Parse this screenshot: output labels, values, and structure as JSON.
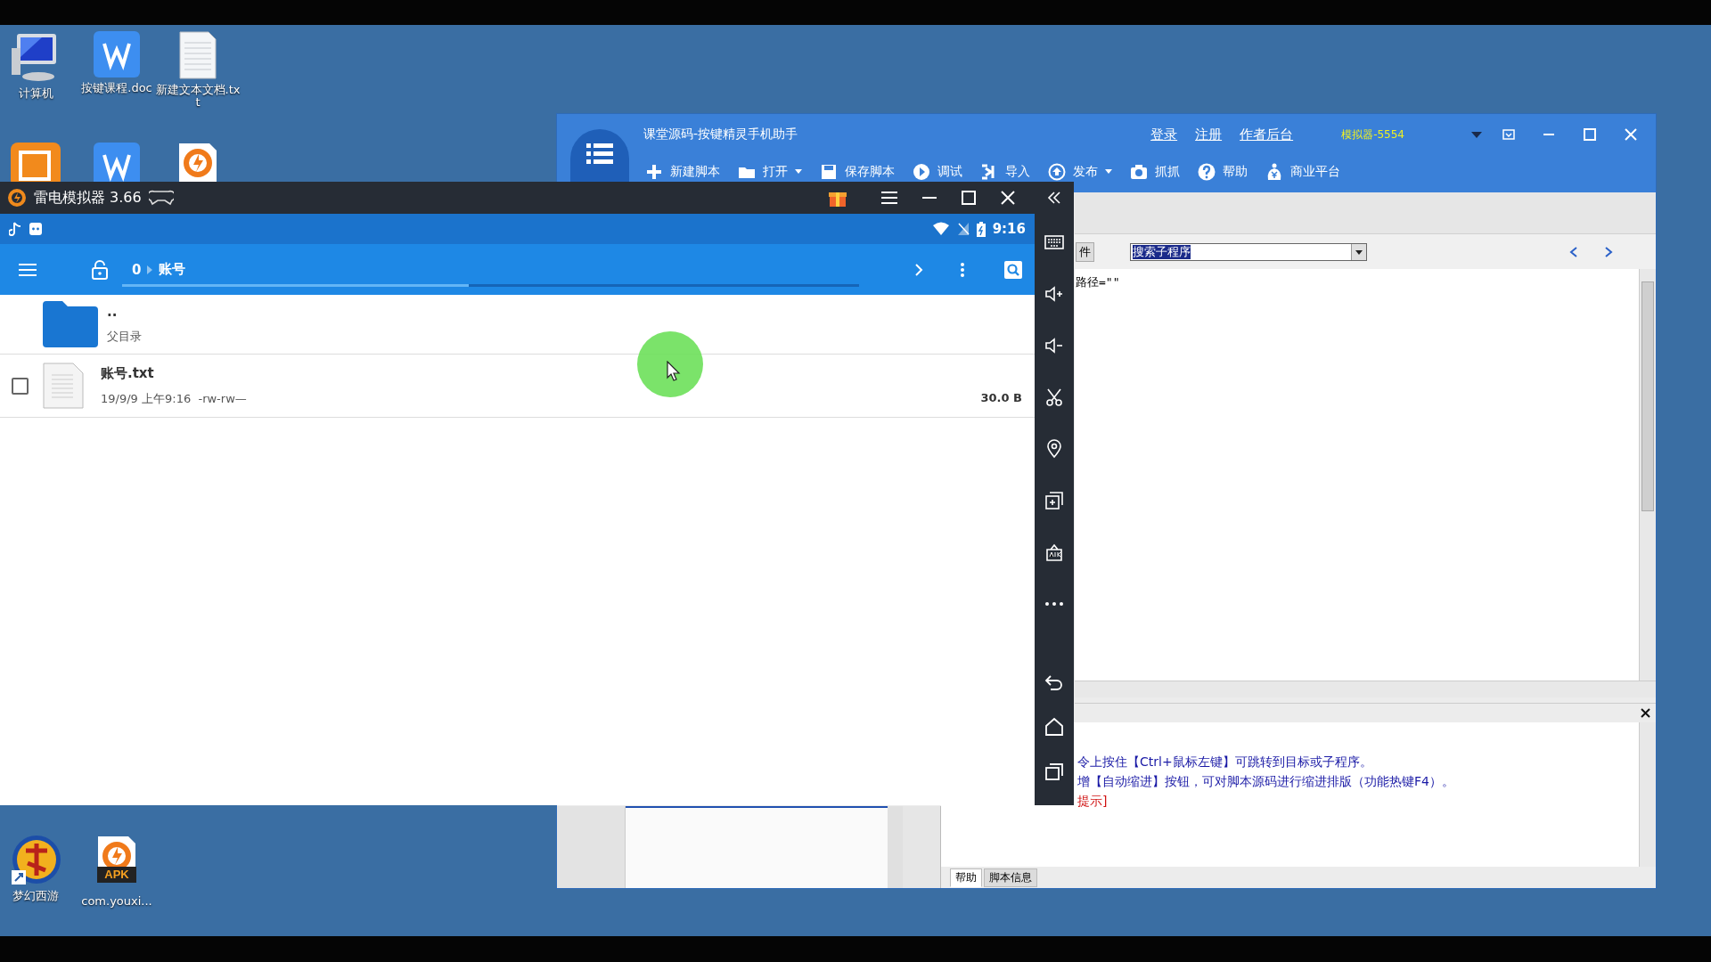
{
  "desktop_icons": [
    {
      "label": "计算机",
      "kind": "computer"
    },
    {
      "label": "按键课程.doc",
      "kind": "word"
    },
    {
      "label": "新建文本文档.txt",
      "kind": "text"
    },
    {
      "kind": "flash"
    },
    {
      "kind": "word"
    },
    {
      "kind": "ld"
    }
  ],
  "bottom_icons": [
    {
      "label": "梦幻西游",
      "kind": "game"
    },
    {
      "label": "com.youxi...",
      "kind": "apk",
      "badge": "APK"
    }
  ],
  "editor": {
    "title": "课堂源码-按键精灵手机助手",
    "links": [
      "登录",
      "注册",
      "作者后台"
    ],
    "device": "模拟器-5554",
    "toolbar": [
      {
        "label": "新建脚本",
        "kind": "plus",
        "dropdown": false
      },
      {
        "label": "打开",
        "kind": "folder",
        "dropdown": true
      },
      {
        "label": "保存脚本",
        "kind": "save",
        "dropdown": false
      },
      {
        "label": "调试",
        "kind": "play",
        "dropdown": false
      },
      {
        "label": "导入",
        "kind": "import",
        "dropdown": false
      },
      {
        "label": "发布",
        "kind": "publish",
        "dropdown": true
      },
      {
        "label": "抓抓",
        "kind": "camera",
        "dropdown": false
      },
      {
        "label": "帮助",
        "kind": "help",
        "dropdown": false
      },
      {
        "label": "商业平台",
        "kind": "money",
        "dropdown": false
      }
    ],
    "tab_fragment": "件",
    "search": {
      "value": "搜索子程序"
    },
    "code_lines": [
      "路径=\"\""
    ],
    "log_lines": [
      {
        "text": "令上按住【Ctrl+鼠标左键】可跳转到目标或子程序。",
        "color": "#1a1aa6"
      },
      {
        "text": "增【自动缩进】按钮，可对脚本源码进行缩进排版（功能热键F4）。",
        "color": "#1a1aa6"
      },
      {
        "text": "提示]",
        "color": "#d01010"
      }
    ],
    "bottom_tabs": [
      {
        "label": "帮助",
        "selected": true
      },
      {
        "label": "脚本信息",
        "selected": false
      }
    ]
  },
  "emulator": {
    "title": "雷电模拟器 3.66",
    "time": "9:16",
    "path": [
      {
        "label": "0"
      },
      {
        "label": "账号"
      }
    ],
    "progress": {
      "level": 0.47
    },
    "files": [
      {
        "kind": "folder",
        "name": "..",
        "detail": "父目录"
      },
      {
        "kind": "file",
        "name": "账号.txt",
        "detail": "19/9/9 上午9:16",
        "perms": "-rw-rw—",
        "size": "30.0 B",
        "checked": false
      }
    ]
  }
}
